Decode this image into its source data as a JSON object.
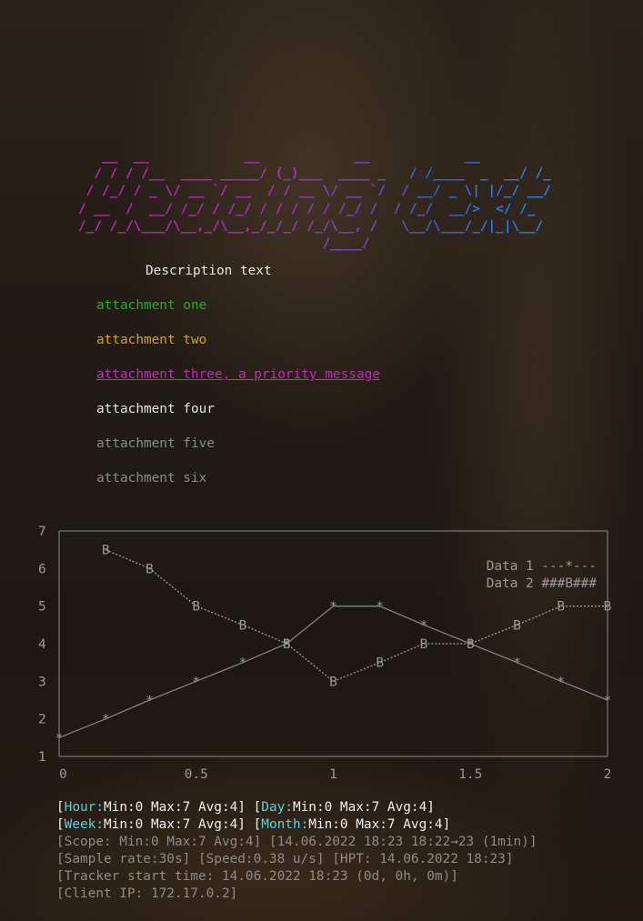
{
  "banner": "   __  __            __            __            __\n  / / / /__  ____ _____/ (_)___  ____ _   / /____  _  __/ /_\n / /_/ / _ \\/ __ `/ __  / / __ \\/ __ `/  / __/ _ \\| |/_/ __/\n/ __  /  __/ /_/ / /_/ / / / / / /_/ /  / /_/  __/>  </ /_\n/_/ /_/\\___/\\__,_/\\__,_/_/_/ /_/\\__, /   \\__/\\___/_/|_|\\__/\n                               /____/",
  "description": "Description text",
  "attachments": [
    {
      "label": "attachment one",
      "color": "#22b022"
    },
    {
      "label": "attachment two",
      "color": "#d4a21a"
    },
    {
      "label": "attachment three, a priority message",
      "color": "#c826c0"
    },
    {
      "label": "attachment four",
      "color": "#e2e2e2"
    },
    {
      "label": "attachment five",
      "color": "#8a8a8a"
    },
    {
      "label": "attachment six",
      "color": "#8a8a8a"
    }
  ],
  "chart_data": {
    "type": "line",
    "title": "",
    "xlabel": "",
    "ylabel": "",
    "xlim": [
      0,
      2
    ],
    "ylim": [
      1,
      7
    ],
    "x_ticks": [
      "0",
      "0.5",
      "1",
      "1.5",
      "2"
    ],
    "y_ticks": [
      "1",
      "2",
      "3",
      "4",
      "5",
      "6",
      "7"
    ],
    "series": [
      {
        "name": "Data 1",
        "marker": "*",
        "line": "---",
        "color": "#bdbdbd",
        "x": [
          0,
          0.17,
          0.33,
          0.5,
          0.67,
          0.83,
          1.0,
          1.17,
          1.33,
          1.5,
          1.67,
          1.83,
          2.0
        ],
        "y": [
          1.5,
          2.0,
          2.5,
          3.0,
          3.5,
          4.0,
          5.0,
          5.0,
          4.5,
          4.0,
          3.5,
          3.0,
          2.5
        ]
      },
      {
        "name": "Data 2",
        "marker": "B",
        "line": "###",
        "color": "#bdbdbd",
        "x": [
          0.17,
          0.33,
          0.5,
          0.67,
          0.83,
          1.0,
          1.17,
          1.33,
          1.5,
          1.67,
          1.83,
          2.0
        ],
        "y": [
          6.5,
          6.0,
          5.0,
          4.5,
          4.0,
          3.0,
          3.5,
          4.0,
          4.0,
          4.5,
          5.0,
          5.0
        ]
      }
    ],
    "legend_position": "top-right",
    "legend": [
      "Data 1 ---*---",
      "Data 2 ###B###"
    ],
    "highlight_marker_color": "#5ed0d8"
  },
  "stats": {
    "hour_label": "Hour:",
    "hour_value": "Min:0 Max:7 Avg:4",
    "day_label": "Day:",
    "day_value": "Min:0 Max:7 Avg:4",
    "week_label": "Week:",
    "week_value": "Min:0 Max:7 Avg:4",
    "month_label": "Month:",
    "month_value": "Min:0 Max:7 Avg:4",
    "scope": "[Scope: Min:0 Max:7 Avg:4] [14.06.2022 18:23 18:22→23 (1min)]",
    "sample": "[Sample rate:30s] [Speed:0.38 u/s] [HPT: 14.06.2022 18:23]",
    "tracker": "[Tracker start time: 14.06.2022 18:23 (0d, 0h, 0m)]",
    "client": "[Client IP: 172.17.0.2]"
  }
}
